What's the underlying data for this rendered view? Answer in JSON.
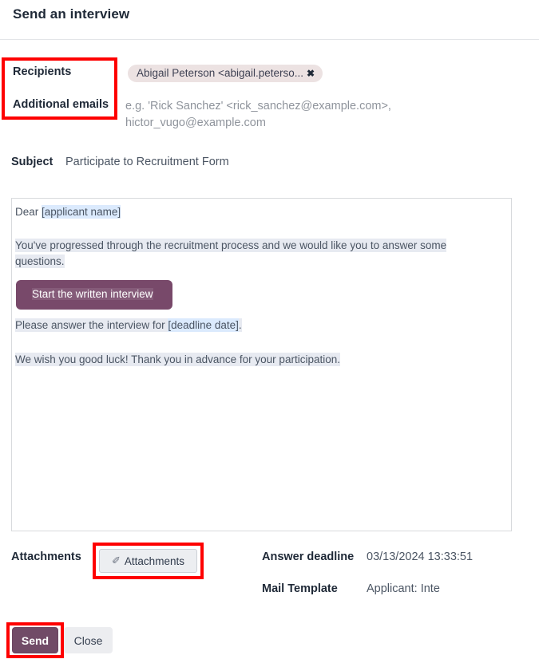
{
  "dialog": {
    "title": "Send an interview"
  },
  "form": {
    "recipients_label": "Recipients",
    "additional_emails_label": "Additional emails",
    "recipient_chip": {
      "text": "Abigail Peterson <abigail.peterso...",
      "remove_icon": "close-icon",
      "remove_glyph": "✖"
    },
    "additional_emails_placeholder": "e.g.  'Rick Sanchez' <rick_sanchez@example.com>, hictor_vugo@example.com",
    "subject_label": "Subject",
    "subject_value": "Participate to Recruitment Form"
  },
  "mail_body": {
    "greeting_prefix": "Dear ",
    "greeting_token": "[applicant name]",
    "paragraph_1": "You've progressed through the recruitment process and we would like you to answer some questions.",
    "cta_label": "Start the written interview",
    "deadline_prefix": "Please answer the interview for ",
    "deadline_token": "[deadline date]",
    "deadline_suffix": ".",
    "closing": "We wish you good luck! Thank you in advance for your participation."
  },
  "attachments": {
    "label": "Attachments",
    "button_label": "Attachments",
    "button_icon": "paperclip-icon",
    "button_glyph": "✐"
  },
  "details": {
    "answer_deadline_label": "Answer deadline",
    "answer_deadline_value": "03/13/2024 13:33:51",
    "mail_template_label": "Mail Template",
    "mail_template_value": "Applicant: Inte"
  },
  "footer": {
    "send_label": "Send",
    "close_label": "Close"
  },
  "colors": {
    "primary_purple": "#714B67",
    "cta_purple": "#78496A",
    "chip_background": "#ECE2E2",
    "highlight_blue": "#DBEAFD",
    "highlight_gray": "#E7EAF1",
    "annotation_red": "#FE0000"
  }
}
